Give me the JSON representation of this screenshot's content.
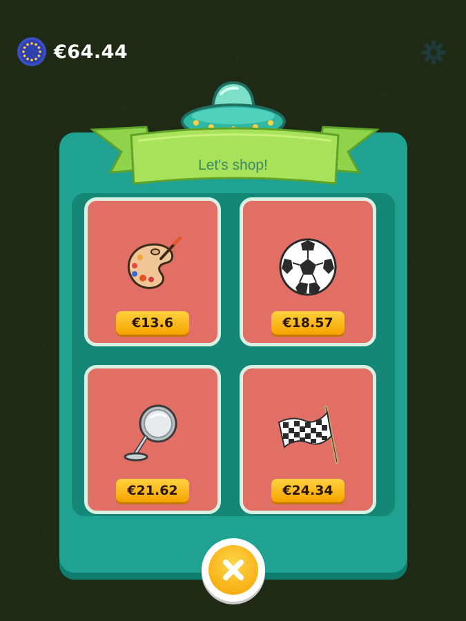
{
  "wallet": {
    "balance": "€64.44",
    "icon": "euro-coin-icon"
  },
  "settings": {
    "icon": "gear-icon"
  },
  "shop": {
    "title": "Let's shop!",
    "items": [
      {
        "icon": "palette-icon",
        "price": "€13.6"
      },
      {
        "icon": "soccer-ball-icon",
        "price": "€18.57"
      },
      {
        "icon": "magnifying-mirror-icon",
        "price": "€21.62"
      },
      {
        "icon": "checkered-flag-icon",
        "price": "€24.34"
      }
    ]
  },
  "close": {
    "icon": "close-icon"
  },
  "colors": {
    "background": "#1e2a14",
    "panel": "#1fa292",
    "card": "#e26f66",
    "price_tag": "#f5a300",
    "ribbon": "#8fd34a"
  }
}
